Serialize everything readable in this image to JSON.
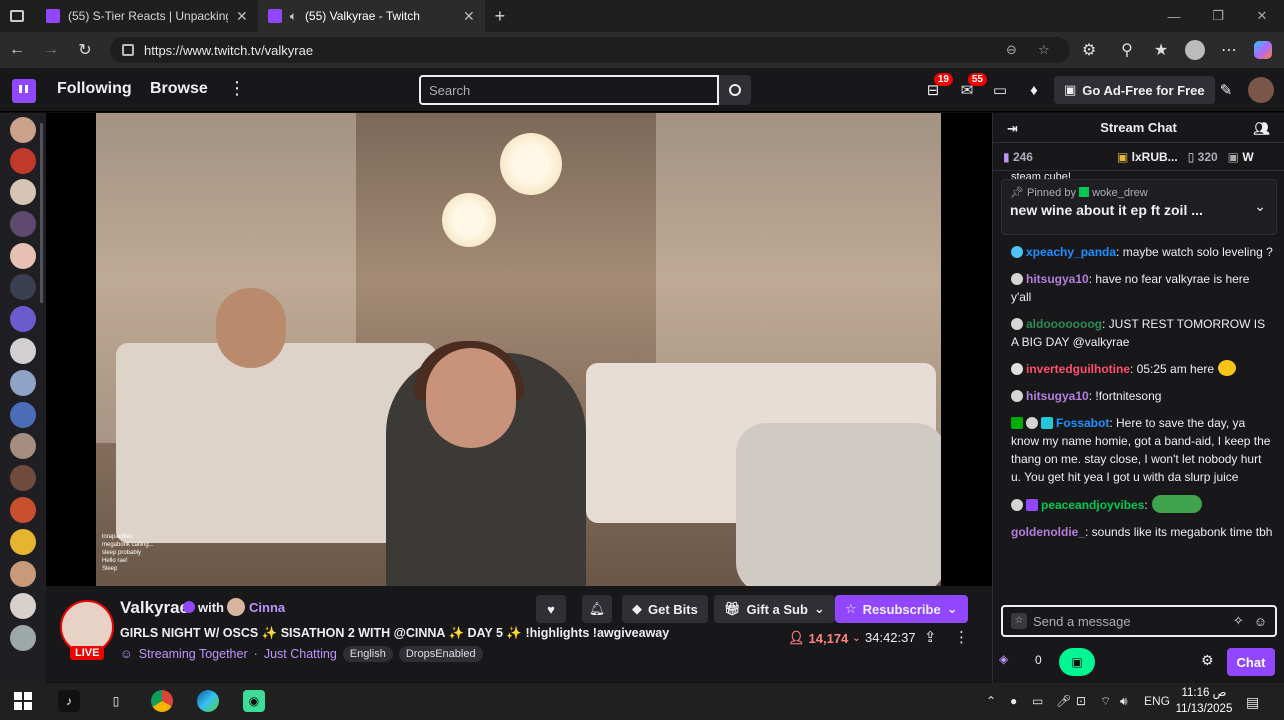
{
  "browser": {
    "tabs": [
      {
        "title": "(55) S-Tier Reacts | Unpacking Dr"
      },
      {
        "title": "(55) Valkyrae - Twitch"
      }
    ],
    "url": "https://www.twitch.tv/valkyrae"
  },
  "topnav": {
    "following": "Following",
    "browse": "Browse",
    "search_placeholder": "Search",
    "notif_count": "19",
    "inbox_count": "55",
    "adfree_label": "Go Ad-Free for Free"
  },
  "stream": {
    "streamer": "Valkyrae",
    "with_label": "with",
    "collab": "Cinna",
    "live_label": "LIVE",
    "title": "GIRLS NIGHT W/ OSCS ✨ SISATHON 2 WITH @CINNA ✨ DAY 5 ✨ !highlights !awgiveaway",
    "streaming_together": "Streaming Together",
    "sep": "·",
    "category": "Just Chatting",
    "tags": [
      "English",
      "DropsEnabled"
    ],
    "get_bits": "Get Bits",
    "gift_sub": "Gift a Sub",
    "resubscribe": "Resubscribe",
    "viewers": "14,174",
    "uptime": "34:42:37"
  },
  "video_overlay_chat": [
    "lnrapacblec: ...",
    "megabonk calling...",
    "sleep probably",
    "Hello rae!",
    "Sleep"
  ],
  "chat": {
    "header": "Stream Chat",
    "leaderboard": [
      {
        "label": "246"
      },
      {
        "label": "lxRUB..."
      },
      {
        "label": "320"
      },
      {
        "label": "W"
      }
    ],
    "partial_top": "steam cube!",
    "pinned_by_label": "Pinned by",
    "pinned_by": "woke_drew",
    "pinned_msg": "new wine about it ep ft zoil ...",
    "messages": [
      {
        "user": "xpeachy_panda",
        "color": "#1e90ff",
        "text": ": maybe watch solo leveling ?"
      },
      {
        "user": "hitsugya10",
        "color": "#b57edc",
        "text": ": have no fear valkyrae is here y'all"
      },
      {
        "user": "aldooooooog",
        "color": "#2e8b57",
        "text": ": JUST REST TOMORROW IS A BIG DAY @valkyrae"
      },
      {
        "user": "invertedguilhotine",
        "color": "#ff4f6d",
        "text": ": 05:25 am here"
      },
      {
        "user": "hitsugya10",
        "color": "#b57edc",
        "text": ": !fortnitesong"
      },
      {
        "user": "Fossabot",
        "color": "#1e90ff",
        "text": ": Here to save the day, ya know my name homie, got a band-aid, I keep the thang on me. stay close, I won't let nobody hurt u. You get hit yea I got u with da slurp juice"
      },
      {
        "user": "peaceandjoyvibes",
        "color": "#00c853",
        "text": ":"
      },
      {
        "user": "goldenoldie_",
        "color": "#b57edc",
        "text": ": sounds like its megabonk time tbh"
      }
    ],
    "input_placeholder": "Send a message",
    "points": "0",
    "chat_button": "Chat"
  },
  "taskbar": {
    "lang": "ENG",
    "time": "11:16 ص",
    "date": "11/13/2025"
  }
}
